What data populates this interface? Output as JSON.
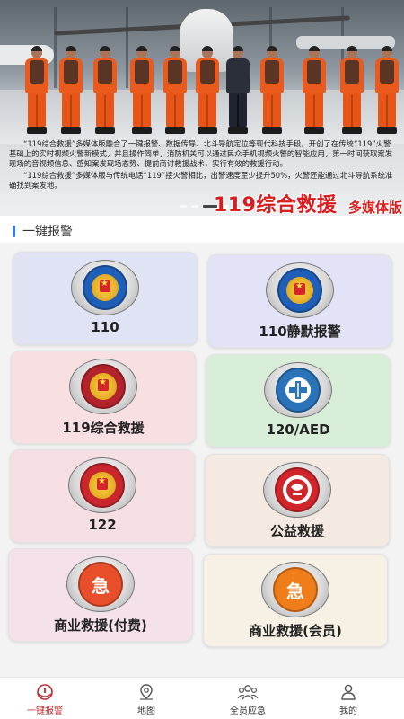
{
  "banner": {
    "paragraph1": "“119综合救援”多媒体版融合了一键报警、数据传导、北斗导航定位等现代科技手段，开创了在传统“119”火警基础上的实时视频火警新模式，并且操作简单，消防机关可以通过民众手机视频火警的智能应用，第一时间获取案发现场的音视频信息、感知案发现场态势、提前商讨救援战术，实行有效的救援行动。",
    "paragraph2": "“119综合救援”多媒体版与传统电话“119”接火警相比，出警速度至少提升50%，火警还能通过北斗导航系统准确找到案发地。",
    "title": "119综合救援",
    "subtitle": "多媒体版",
    "active_slide": 3,
    "slide_count": 4
  },
  "section": {
    "title": "一键报警"
  },
  "cards": [
    {
      "label": "110",
      "icon": "police-badge-icon",
      "bg": "#dfe3f4",
      "inner": "#1f5fb7"
    },
    {
      "label": "110静默报警",
      "icon": "police-badge-icon",
      "bg": "#e2e3f6",
      "inner": "#1f5fb7"
    },
    {
      "label": "119综合救援",
      "icon": "fire-rescue-badge-icon",
      "bg": "#f7dfe2",
      "inner": "#b3232c"
    },
    {
      "label": "120/AED",
      "icon": "medical-cross-icon",
      "bg": "#d9eed9",
      "inner": "#2a73b8"
    },
    {
      "label": "122",
      "icon": "traffic-police-badge-icon",
      "bg": "#f6dfe3",
      "inner": "#c9262d"
    },
    {
      "label": "公益救援",
      "icon": "charity-rescue-icon",
      "bg": "#f5eae2",
      "inner": "#d0262b"
    },
    {
      "label": "商业救援(付费)",
      "icon": "emergency-ji-icon",
      "bg": "#f4e1ea",
      "inner": "#e94e2a",
      "badge_text": "急"
    },
    {
      "label": "商业救援(会员)",
      "icon": "emergency-ji-icon",
      "bg": "#f6f1e4",
      "inner": "#ef7d1a",
      "badge_text": "急"
    }
  ],
  "nav": [
    {
      "label": "一键报警",
      "icon": "alarm-icon",
      "active": true
    },
    {
      "label": "地图",
      "icon": "map-pin-icon",
      "active": false
    },
    {
      "label": "全员应急",
      "icon": "group-icon",
      "active": false
    },
    {
      "label": "我的",
      "icon": "person-icon",
      "active": false
    }
  ],
  "colors": {
    "accent": "#2f7bf0",
    "brand_red": "#d81e1e",
    "nav_active": "#c0292b"
  }
}
